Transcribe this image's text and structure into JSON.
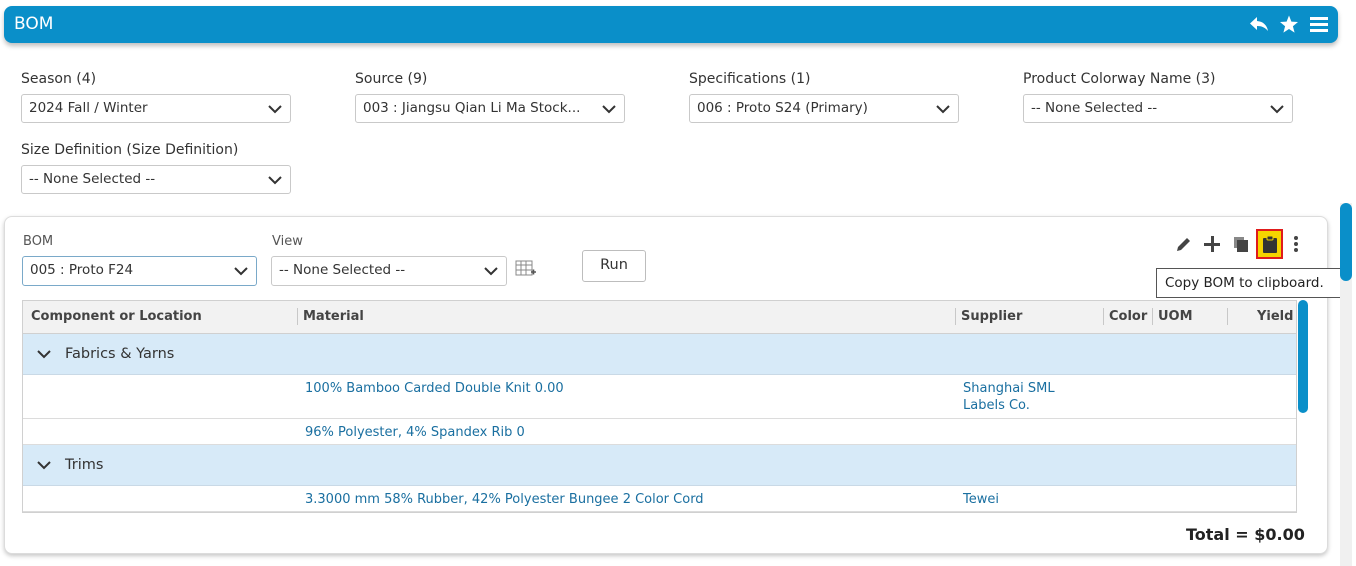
{
  "header": {
    "title": "BOM",
    "icons": [
      "reply-icon",
      "star-icon",
      "menu-icon"
    ]
  },
  "filters": {
    "season": {
      "label": "Season (4)",
      "value": "2024 Fall / Winter"
    },
    "source": {
      "label": "Source (9)",
      "value": "003 : Jiangsu Qian Li Ma Stock..."
    },
    "specifications": {
      "label": "Specifications (1)",
      "value": "006 : Proto S24 (Primary)"
    },
    "colorway": {
      "label": "Product Colorway Name (3)",
      "value": "-- None Selected --"
    },
    "size_definition": {
      "label": "Size Definition (Size Definition)",
      "value": "-- None Selected --"
    }
  },
  "bom_panel": {
    "bom_label": "BOM",
    "bom_value": "005 : Proto F24",
    "view_label": "View",
    "view_value": "-- None Selected --",
    "run_label": "Run",
    "toolbar_icons": [
      "edit-icon",
      "add-icon",
      "copy-icon",
      "clipboard-icon",
      "more-icon"
    ],
    "tooltip": "Copy BOM to clipboard."
  },
  "table": {
    "columns": [
      "Component or Location",
      "Material",
      "Supplier",
      "Color",
      "UOM",
      "Yield"
    ],
    "groups": [
      {
        "name": "Fabrics & Yarns",
        "rows": [
          {
            "material": "100% Bamboo Carded Double Knit 0.00",
            "supplier_line1": "Shanghai SML",
            "supplier_line2": "Labels Co."
          },
          {
            "material": "96% Polyester, 4% Spandex Rib 0",
            "supplier_line1": "",
            "supplier_line2": ""
          }
        ]
      },
      {
        "name": "Trims",
        "rows": [
          {
            "material": "3.3000 mm 58% Rubber, 42% Polyester Bungee 2 Color Cord",
            "supplier_line1": "Tewei",
            "supplier_line2": ""
          }
        ]
      }
    ]
  },
  "total": "Total = $0.00",
  "colors": {
    "accent": "#0a8fc9",
    "group_row": "#d7eaf8",
    "link": "#1a6fa0",
    "highlight": "#f5d400"
  }
}
